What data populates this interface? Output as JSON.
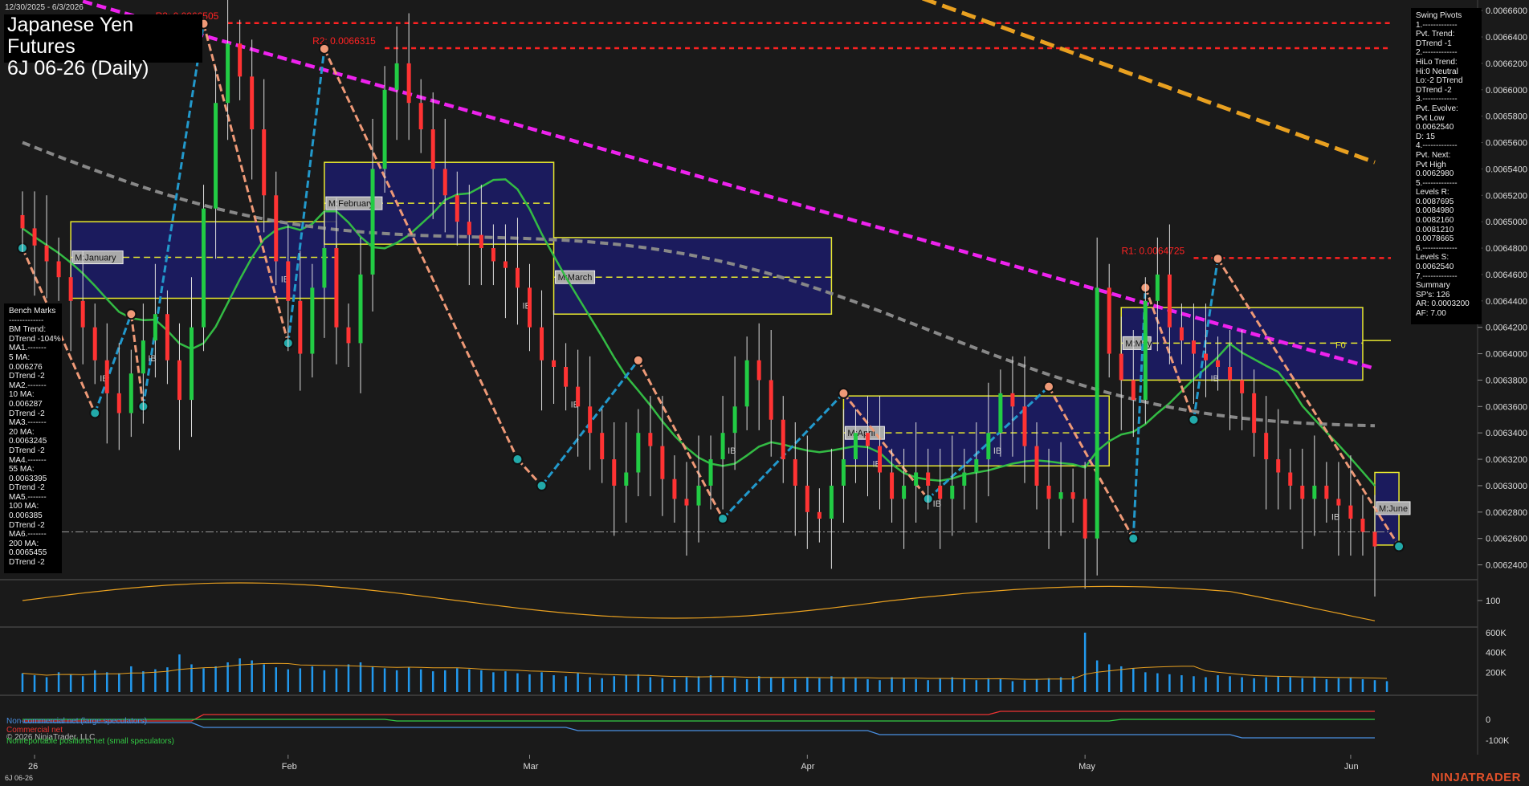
{
  "date_range": "12/30/2025 - 6/3/2026",
  "title_line1": "Japanese Yen Futures",
  "title_line2": "6J 06-26 (Daily)",
  "symbol_footer": "6J 06-26",
  "brand": "NINJATRADER",
  "colors": {
    "background": "#1a1a1a",
    "up_candle": "#22cc44",
    "down_candle": "#ff3333",
    "ma20": "#33bb44",
    "ma100": "#888888",
    "ma200": "#ee22ee",
    "long_ma": "#e8a020",
    "pivot_line": "#ff2222",
    "month_box_fill": "#1c1c6a",
    "month_box_border": "#e8e830",
    "up_swing": "#2299cc",
    "down_swing": "#ee9977",
    "volume": "#2299ee",
    "osc": "#e8a020"
  },
  "benchmarks_panel": [
    "Bench Marks",
    "-------------",
    "BM Trend:",
    "DTrend -104%",
    "MA1.-------",
    "5 MA:",
    "0.006276",
    "DTrend -2",
    "MA2.-------",
    "10 MA:",
    "0.006287",
    "DTrend -2",
    "MA3.-------",
    "20 MA:",
    "0.0063245",
    "DTrend -2",
    "MA4.-------",
    "55 MA:",
    "0.0063395",
    "DTrend -2",
    "MA5.-------",
    "100 MA:",
    "0.006385",
    "DTrend -2",
    "MA6.-------",
    "200 MA:",
    "0.0065455",
    "DTrend -2"
  ],
  "swing_panel": [
    "Swing Pivots",
    "1.-------------",
    "Pvt. Trend:",
    "DTrend -1",
    "2.-------------",
    "HiLo Trend:",
    "Hi:0 Neutral",
    "Lo:-2 DTrend",
    "DTrend -2",
    "3.-------------",
    "Pvt. Evolve:",
    "Pvt Low",
    "0.0062540",
    "D: 15",
    "4.-------------",
    "Pvt. Next:",
    "Pvt High",
    "0.0062980",
    "5.-------------",
    "Levels R:",
    "0.0087695",
    "0.0084980",
    "0.0082160",
    "0.0081210",
    "0.0078665",
    "6.-------------",
    "Levels S:",
    "0.0062540",
    "7.-------------",
    "Summary",
    "SP's: 126",
    "AR: 0.0003200",
    "AF: 7.00"
  ],
  "legend": {
    "noncommercial": "Non-commercial net (large speculators)",
    "commercial": "Commercial net",
    "copyright": "© 2026 NinjaTrader, LLC",
    "nonreportable": "Nonreportable positions net (small speculators)"
  },
  "chart_data": {
    "type": "candlestick",
    "price_axis": {
      "ticks": [
        "0.0066600",
        "0.0066400",
        "0.0066200",
        "0.0066000",
        "0.0065800",
        "0.0065600",
        "0.0065400",
        "0.0065200",
        "0.0065000",
        "0.0064800",
        "0.0064600",
        "0.0064400",
        "0.0064200",
        "0.0064000",
        "0.0063800",
        "0.0063600",
        "0.0063400",
        "0.0063200",
        "0.0063000",
        "0.0062800",
        "0.0062600",
        "0.0062400"
      ],
      "range": [
        0.00623,
        0.006668
      ]
    },
    "x_ticks": [
      {
        "label": "26",
        "idx": 1
      },
      {
        "label": "Feb",
        "idx": 22
      },
      {
        "label": "Mar",
        "idx": 42
      },
      {
        "label": "Apr",
        "idx": 65
      },
      {
        "label": "May",
        "idx": 88
      },
      {
        "label": "Jun",
        "idx": 110
      }
    ],
    "closes": [
      0.006495,
      0.006482,
      0.00647,
      0.006458,
      0.00644,
      0.00642,
      0.006395,
      0.00637,
      0.006355,
      0.006385,
      0.00641,
      0.00643,
      0.006395,
      0.006365,
      0.00642,
      0.00651,
      0.00659,
      0.006635,
      0.00661,
      0.00657,
      0.00652,
      0.00647,
      0.00644,
      0.0064,
      0.00645,
      0.00648,
      0.00642,
      0.006408,
      0.00646,
      0.00654,
      0.0066,
      0.00662,
      0.00659,
      0.00657,
      0.00654,
      0.00652,
      0.0065,
      0.00649,
      0.00648,
      0.00647,
      0.006465,
      0.00645,
      0.00642,
      0.006395,
      0.00639,
      0.006375,
      0.00636,
      0.00634,
      0.00632,
      0.0063,
      0.00631,
      0.00634,
      0.00633,
      0.006305,
      0.00629,
      0.006285,
      0.0063,
      0.00632,
      0.00634,
      0.00636,
      0.006395,
      0.00638,
      0.00635,
      0.00632,
      0.0063,
      0.00628,
      0.006275,
      0.0063,
      0.00632,
      0.00634,
      0.00633,
      0.00631,
      0.00629,
      0.0063,
      0.00631,
      0.0063,
      0.00629,
      0.0063,
      0.00631,
      0.00632,
      0.00634,
      0.00637,
      0.00636,
      0.00633,
      0.0063,
      0.00629,
      0.006295,
      0.00629,
      0.00626,
      0.00645,
      0.0064,
      0.00638,
      0.006365,
      0.00644,
      0.00646,
      0.00642,
      0.00641,
      0.0064,
      0.006395,
      0.00639,
      0.00638,
      0.00637,
      0.00634,
      0.00632,
      0.00631,
      0.0063,
      0.00629,
      0.0063,
      0.00629,
      0.006285,
      0.006275,
      0.006265,
      0.006254
    ],
    "pivot_levels": [
      {
        "label": "R3: 0.0066505",
        "value": 0.0066505
      },
      {
        "label": "R2: 0.0066315",
        "value": 0.0066315
      },
      {
        "label": "R1: 0.0064725",
        "value": 0.0064725
      }
    ],
    "month_boxes": [
      {
        "label": "M:January",
        "from": 4,
        "to": 26,
        "high": 0.0065,
        "low": 0.006442,
        "mid": 0.006473
      },
      {
        "label": "M:February",
        "from": 25,
        "to": 44,
        "high": 0.006545,
        "low": 0.006483,
        "mid": 0.006514
      },
      {
        "label": "M:March",
        "from": 44,
        "to": 67,
        "high": 0.006488,
        "low": 0.00643,
        "mid": 0.006458
      },
      {
        "label": "M:April",
        "from": 68,
        "to": 90,
        "high": 0.006368,
        "low": 0.006315,
        "mid": 0.00634
      },
      {
        "label": "M:May",
        "from": 91,
        "to": 111,
        "high": 0.006435,
        "low": 0.00638,
        "mid": 0.006408
      },
      {
        "label": "M:June",
        "from": 112,
        "to": 114,
        "high": 0.00631,
        "low": 0.006255,
        "mid": 0.006283
      }
    ],
    "month_box_marker": "F0",
    "osc_label": "100",
    "volume_ticks": [
      "600K",
      "400K",
      "200K"
    ],
    "cot_ticks": [
      "0",
      "-100K"
    ],
    "ib_label": "IB",
    "volume": [
      190,
      170,
      150,
      200,
      180,
      160,
      220,
      200,
      190,
      260,
      210,
      230,
      250,
      380,
      280,
      240,
      260,
      300,
      340,
      320,
      280,
      250,
      230,
      240,
      260,
      220,
      240,
      280,
      300,
      260,
      240,
      220,
      250,
      230,
      210,
      220,
      240,
      230,
      220,
      200,
      210,
      190,
      180,
      200,
      170,
      160,
      190,
      150,
      140,
      160,
      170,
      180,
      150,
      140,
      130,
      150,
      160,
      170,
      150,
      140,
      130,
      160,
      150,
      140,
      130,
      150,
      140,
      160,
      150,
      140,
      130,
      120,
      150,
      140,
      130,
      120,
      140,
      150,
      130,
      120,
      140,
      130,
      110,
      120,
      130,
      140,
      150,
      160,
      600,
      320,
      280,
      260,
      240,
      200,
      190,
      180,
      170,
      160,
      150,
      170,
      160,
      150,
      140,
      150,
      160,
      150,
      140,
      150,
      130,
      140,
      150,
      130,
      120,
      110
    ]
  }
}
